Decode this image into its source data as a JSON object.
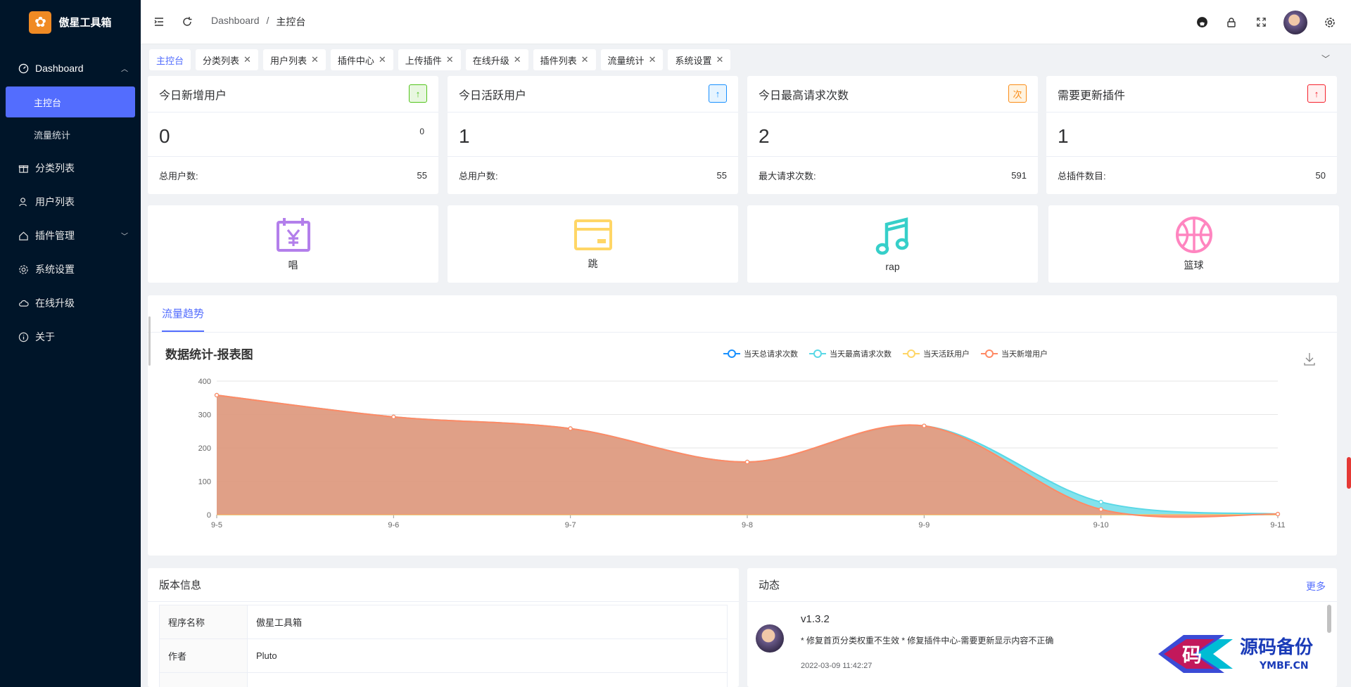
{
  "app": {
    "name": "傲星工具箱"
  },
  "sidebar": {
    "items": [
      {
        "label": "Dashboard",
        "children": [
          "主控台",
          "流量统计"
        ]
      },
      {
        "label": "分类列表"
      },
      {
        "label": "用户列表"
      },
      {
        "label": "插件管理"
      },
      {
        "label": "系统设置"
      },
      {
        "label": "在线升级"
      },
      {
        "label": "关于"
      }
    ]
  },
  "header": {
    "breadcrumb": [
      "Dashboard",
      "/",
      "主控台"
    ]
  },
  "tabs": [
    "主控台",
    "分类列表",
    "用户列表",
    "插件中心",
    "上传插件",
    "在线升级",
    "插件列表",
    "流量统计",
    "系统设置"
  ],
  "stats": [
    {
      "title": "今日新增用户",
      "badge": "↑",
      "badge_color": "#52c41a",
      "badge_bg": "#e8f7e0",
      "value": "0",
      "small": "0",
      "foot_label": "总用户数:",
      "foot_value": "55"
    },
    {
      "title": "今日活跃用户",
      "badge": "↑",
      "badge_color": "#1890ff",
      "badge_bg": "#e6f4ff",
      "value": "1",
      "small": "",
      "foot_label": "总用户数:",
      "foot_value": "55"
    },
    {
      "title": "今日最高请求次数",
      "badge": "次",
      "badge_color": "#fa8c16",
      "badge_bg": "#fff3e0",
      "value": "2",
      "small": "",
      "foot_label": "最大请求次数:",
      "foot_value": "591"
    },
    {
      "title": "需要更新插件",
      "badge": "↑",
      "badge_color": "#f5222d",
      "badge_bg": "#fff0f0",
      "value": "1",
      "small": "",
      "foot_label": "总插件数目:",
      "foot_value": "50"
    }
  ],
  "shortcuts": [
    {
      "label": "唱",
      "icon": "calendar-yen-icon",
      "color": "#b37feb"
    },
    {
      "label": "跳",
      "icon": "credit-card-icon",
      "color": "#ffd666"
    },
    {
      "label": "rap",
      "icon": "music-note-icon",
      "color": "#36cfc9"
    },
    {
      "label": "篮球",
      "icon": "basketball-icon",
      "color": "#ff85c0"
    }
  ],
  "chart_tab": "流量趋势",
  "chart_data": {
    "type": "area",
    "title": "数据统计-报表图",
    "categories": [
      "9-5",
      "9-6",
      "9-7",
      "9-8",
      "9-9",
      "9-10",
      "9-11"
    ],
    "ylim": [
      0,
      400
    ],
    "yticks": [
      0,
      100,
      200,
      300,
      400
    ],
    "grid": true,
    "legend": "top-center",
    "series": [
      {
        "name": "当天总请求次数",
        "color": "#1890ff",
        "values": [
          0,
          0,
          0,
          0,
          0,
          0,
          0
        ]
      },
      {
        "name": "当天最高请求次数",
        "color": "#5ad8e6",
        "values": [
          358,
          293,
          258,
          158,
          266,
          38,
          2
        ]
      },
      {
        "name": "当天活跃用户",
        "color": "#ffd666",
        "values": [
          0,
          0,
          0,
          0,
          0,
          0,
          0
        ]
      },
      {
        "name": "当天新增用户",
        "color": "#ff8a65",
        "values": [
          358,
          293,
          258,
          158,
          266,
          16,
          2
        ]
      }
    ]
  },
  "version": {
    "title": "版本信息",
    "rows": [
      {
        "key": "程序名称",
        "value": "傲星工具箱"
      },
      {
        "key": "作者",
        "value": "Pluto"
      },
      {
        "key": "",
        "value": ""
      }
    ]
  },
  "news": {
    "title": "动态",
    "more": "更多",
    "items": [
      {
        "version": "v1.3.2",
        "desc": "* 修复首页分类权重不生效 * 修复插件中心-需要更新显示内容不正确",
        "time": "2022-03-09 11:42:27"
      }
    ]
  },
  "watermark": {
    "text": "源码备份",
    "sub": "YMBF.CN",
    "char": "码"
  }
}
